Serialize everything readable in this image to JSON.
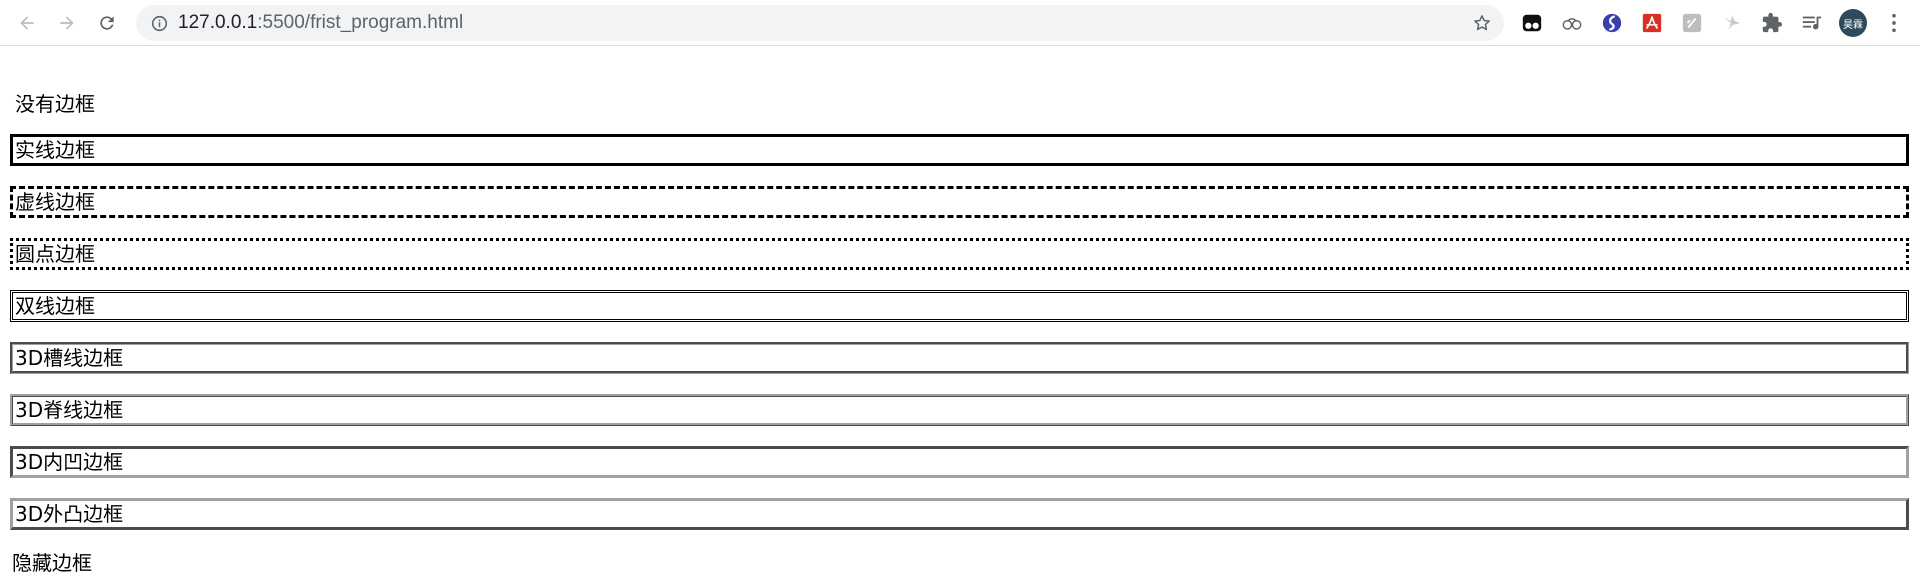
{
  "browser": {
    "url_host": "127.0.0.1",
    "url_path": ":5500/frist_program.html",
    "avatar_text": "昊霖",
    "icons": {
      "back": "back-arrow-icon",
      "forward": "forward-arrow-icon",
      "reload": "reload-icon",
      "info": "info-icon",
      "bookmark": "star-icon",
      "extensions": [
        "tampermonkey-icon",
        "cloud-sync-icon",
        "circle-s-icon",
        "pdf-icon",
        "gray-square-icon",
        "bird-icon",
        "puzzle-icon",
        "media-queue-icon"
      ],
      "menu": "three-dots-icon"
    }
  },
  "page": {
    "paragraphs": [
      {
        "label": "没有边框",
        "border_style": "none"
      },
      {
        "label": "实线边框",
        "border_style": "solid"
      },
      {
        "label": "虚线边框",
        "border_style": "dashed"
      },
      {
        "label": "圆点边框",
        "border_style": "dotted"
      },
      {
        "label": "双线边框",
        "border_style": "double"
      },
      {
        "label": "3D槽线边框",
        "border_style": "groove"
      },
      {
        "label": "3D脊线边框",
        "border_style": "ridge"
      },
      {
        "label": "3D内凹边框",
        "border_style": "inset"
      },
      {
        "label": "3D外凸边框",
        "border_style": "outset"
      },
      {
        "label": "隐藏边框",
        "border_style": "hidden"
      }
    ]
  }
}
